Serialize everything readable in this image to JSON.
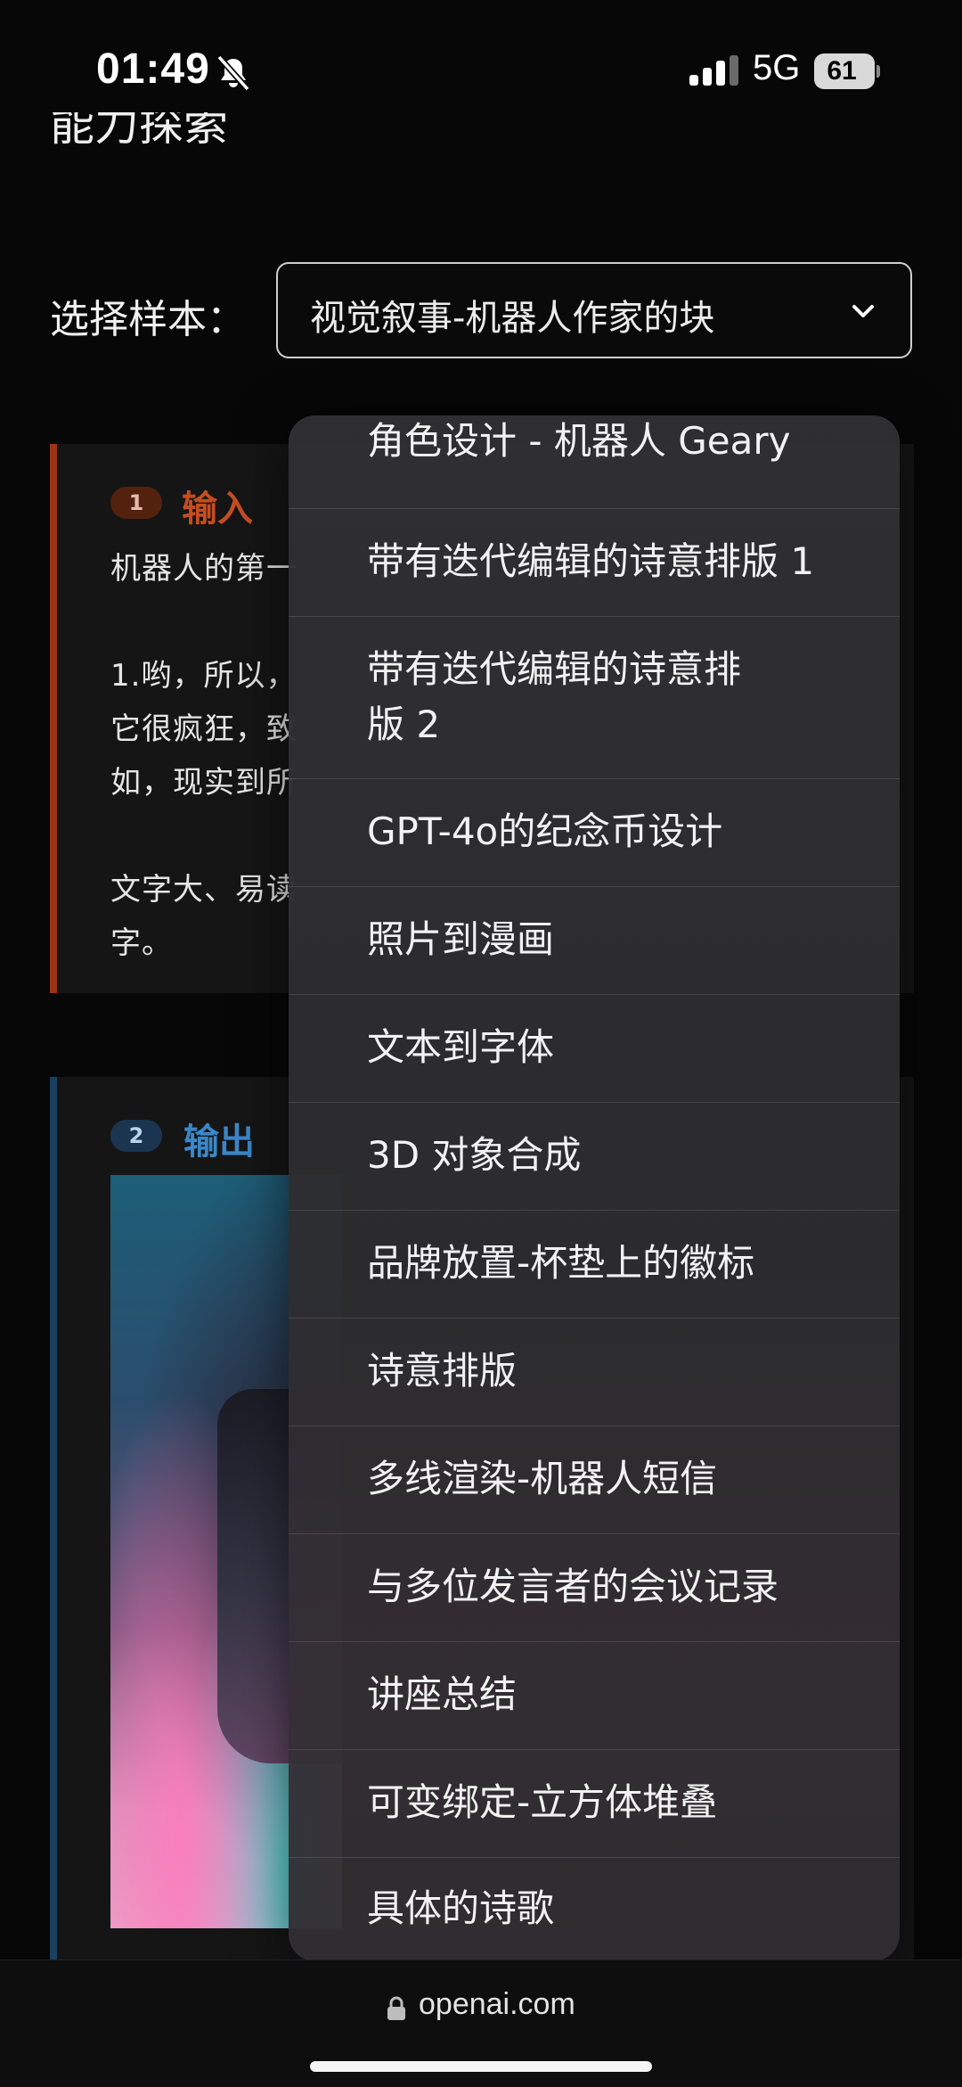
{
  "status_bar": {
    "time": "01:49",
    "network": "5G",
    "battery": "61",
    "icons": [
      "bell-off-icon",
      "signal-icon",
      "battery-icon"
    ]
  },
  "page": {
    "partial_heading": "能力探索",
    "select_label": "选择样本：",
    "select_value": "视觉叙事-机器人作家的块"
  },
  "input_card": {
    "step": "1",
    "title": "输入",
    "lines": [
      "机器人的第一",
      "",
      "1.哟，所以，",
      "它很疯狂，致",
      "如，现实到所",
      "",
      "文字大、易读",
      "字。"
    ]
  },
  "output_card": {
    "step": "2",
    "title": "输出"
  },
  "dropdown": {
    "options": [
      "角色设计 - 机器人 Geary",
      "带有迭代编辑的诗意排版 1",
      "带有迭代编辑的诗意排版 2",
      "GPT-4o的纪念币设计",
      "照片到漫画",
      "文本到字体",
      "3D 对象合成",
      "品牌放置-杯垫上的徽标",
      "诗意排版",
      "多线渲染-机器人短信",
      "与多位发言者的会议记录",
      "讲座总结",
      "可变绑定-立方体堆叠",
      "具体的诗歌"
    ]
  },
  "browser": {
    "url": "openai.com"
  }
}
